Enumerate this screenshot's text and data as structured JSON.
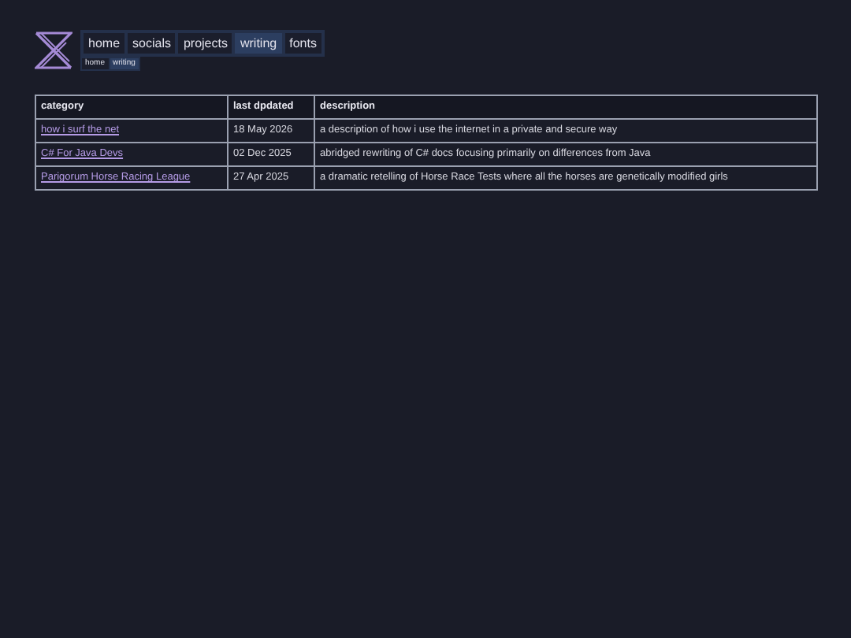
{
  "nav": {
    "items": [
      {
        "label": "home",
        "selected": false
      },
      {
        "label": "socials",
        "selected": false
      },
      {
        "label": "projects",
        "selected": false
      },
      {
        "label": "writing",
        "selected": true
      },
      {
        "label": "fonts",
        "selected": false
      }
    ]
  },
  "breadcrumb": [
    {
      "label": "home",
      "selected": false
    },
    {
      "label": "writing",
      "selected": true
    }
  ],
  "table": {
    "columns": [
      "category",
      "last dpdated",
      "description"
    ],
    "rows": [
      {
        "category": "how i surf the net",
        "date": "18 May 2026",
        "description": "a description of how i use the internet in a private and secure way"
      },
      {
        "category": "C# For Java Devs",
        "date": "02 Dec 2025",
        "description": "abridged rewriting of C# docs focusing primarily on differences from Java"
      },
      {
        "category": "Parigorum Horse Racing League",
        "date": "27 Apr 2025",
        "description": "a dramatic retelling of Horse Race Tests where all the horses are genetically modified girls"
      }
    ]
  }
}
